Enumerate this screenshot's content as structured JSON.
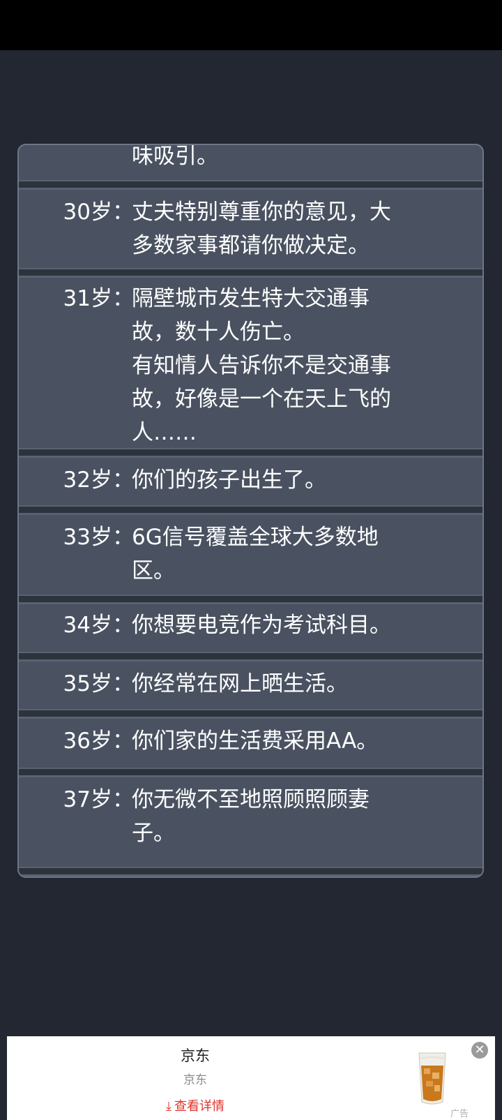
{
  "log": {
    "entries": [
      {
        "age": "",
        "text": "味吸引。"
      },
      {
        "age": "30岁：",
        "text": "丈夫特别尊重你的意见，大\n多数家事都请你做决定。"
      },
      {
        "age": "31岁：",
        "text": "隔壁城市发生特大交通事\n故，数十人伤亡。\n有知情人告诉你不是交通事\n故，好像是一个在天上飞的\n人……"
      },
      {
        "age": "32岁：",
        "text": "你们的孩子出生了。"
      },
      {
        "age": "33岁：",
        "text": "6G信号覆盖全球大多数地\n区。"
      },
      {
        "age": "34岁：",
        "text": "你想要电竞作为考试科目。"
      },
      {
        "age": "35岁：",
        "text": "你经常在网上晒生活。"
      },
      {
        "age": "36岁：",
        "text": "你们家的生活费采用AA。"
      },
      {
        "age": "37岁：",
        "text": "你无微不至地照顾照顾妻\n子。"
      }
    ]
  },
  "ad": {
    "title": "京东",
    "subtitle": "京东",
    "cta": "查看详情",
    "cta_icon": "download-arrow-icon",
    "close_icon": "close-icon",
    "label": "广告",
    "accent_color": "#e1322d"
  }
}
